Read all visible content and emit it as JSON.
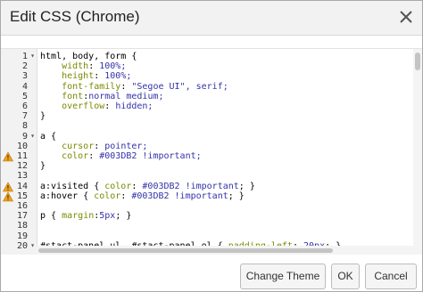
{
  "dialog": {
    "title": "Edit CSS (Chrome)",
    "close_icon": "close-icon"
  },
  "editor": {
    "lines": [
      {
        "num": "1",
        "fold": true,
        "warn": false,
        "text": "html, body, form {"
      },
      {
        "num": "2",
        "fold": false,
        "warn": false,
        "text": "    width: 100%;"
      },
      {
        "num": "3",
        "fold": false,
        "warn": false,
        "text": "    height: 100%;"
      },
      {
        "num": "4",
        "fold": false,
        "warn": false,
        "text": "    font-family: \"Segoe UI\", serif;"
      },
      {
        "num": "5",
        "fold": false,
        "warn": false,
        "text": "    font:normal medium;"
      },
      {
        "num": "6",
        "fold": false,
        "warn": false,
        "text": "    overflow: hidden;"
      },
      {
        "num": "7",
        "fold": false,
        "warn": false,
        "text": "}"
      },
      {
        "num": "8",
        "fold": false,
        "warn": false,
        "text": ""
      },
      {
        "num": "9",
        "fold": true,
        "warn": false,
        "text": "a {"
      },
      {
        "num": "10",
        "fold": false,
        "warn": false,
        "text": "    cursor: pointer;"
      },
      {
        "num": "11",
        "fold": false,
        "warn": true,
        "text": "    color: #003DB2 !important;"
      },
      {
        "num": "12",
        "fold": false,
        "warn": false,
        "text": "}"
      },
      {
        "num": "13",
        "fold": false,
        "warn": false,
        "text": ""
      },
      {
        "num": "14",
        "fold": false,
        "warn": true,
        "text": "a:visited { color: #003DB2 !important; }"
      },
      {
        "num": "15",
        "fold": false,
        "warn": true,
        "text": "a:hover { color: #003DB2 !important; }"
      },
      {
        "num": "16",
        "fold": false,
        "warn": false,
        "text": ""
      },
      {
        "num": "17",
        "fold": false,
        "warn": false,
        "text": "p { margin:5px; }"
      },
      {
        "num": "18",
        "fold": false,
        "warn": false,
        "text": ""
      },
      {
        "num": "19",
        "fold": false,
        "warn": false,
        "text": ""
      },
      {
        "num": "20",
        "fold": true,
        "warn": false,
        "text": "#stact-panel ul, #stact-panel ol { padding-left: 20px; }"
      }
    ]
  },
  "buttons": {
    "change_theme": "Change Theme",
    "ok": "OK",
    "cancel": "Cancel"
  },
  "colors": {
    "gutter_bg": "#f2f2f2",
    "property": "#7a8a00",
    "value": "#3333aa",
    "warning": "#f0a020"
  }
}
